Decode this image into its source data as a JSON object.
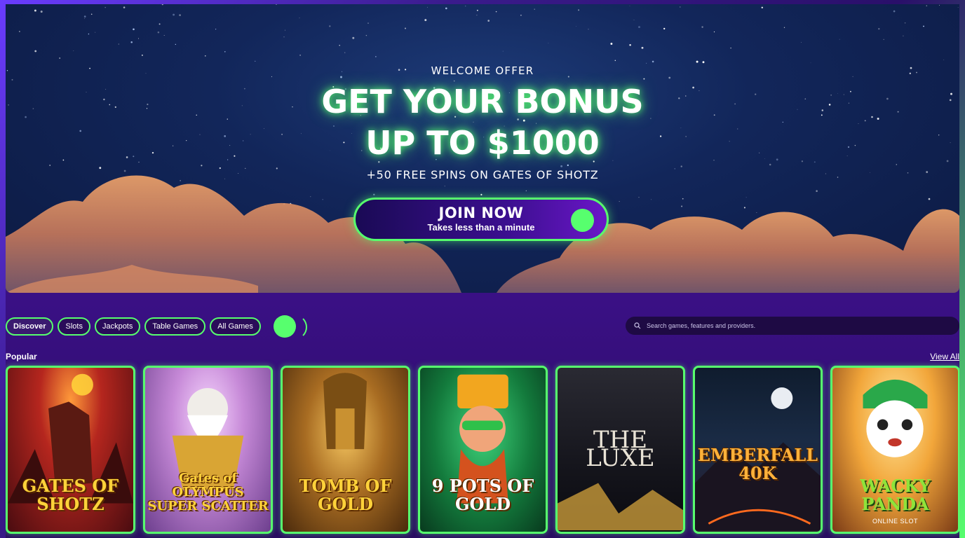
{
  "hero": {
    "eyebrow": "WELCOME OFFER",
    "headline_line1": "GET YOUR BONUS",
    "headline_line2": "UP TO $1000",
    "subline": "+50 FREE SPINS ON GATES OF SHOTZ",
    "cta_title": "JOIN NOW",
    "cta_subtitle": "Takes less than a minute"
  },
  "filters": [
    "Discover",
    "Slots",
    "Jackpots",
    "Table Games",
    "All Games"
  ],
  "active_filter": "Discover",
  "search": {
    "placeholder": "Search games, features and providers."
  },
  "section": {
    "title": "Popular",
    "view_all": "View All"
  },
  "games": [
    {
      "title": "GATES OF SHOTZ",
      "subtitle": ""
    },
    {
      "title": "Gates of OLYMPUS SUPER SCATTER",
      "subtitle": ""
    },
    {
      "title": "TOMB OF GOLD",
      "subtitle": ""
    },
    {
      "title": "9 POTS OF GOLD",
      "subtitle": ""
    },
    {
      "title": "THE LUXE",
      "subtitle": ""
    },
    {
      "title": "EMBERFALL 40K",
      "subtitle": ""
    },
    {
      "title": "WACKY PANDA",
      "subtitle": "ONLINE SLOT"
    }
  ],
  "colors": {
    "accent": "#57ff6e",
    "purple": "#3a1085",
    "night": "#12265a"
  }
}
